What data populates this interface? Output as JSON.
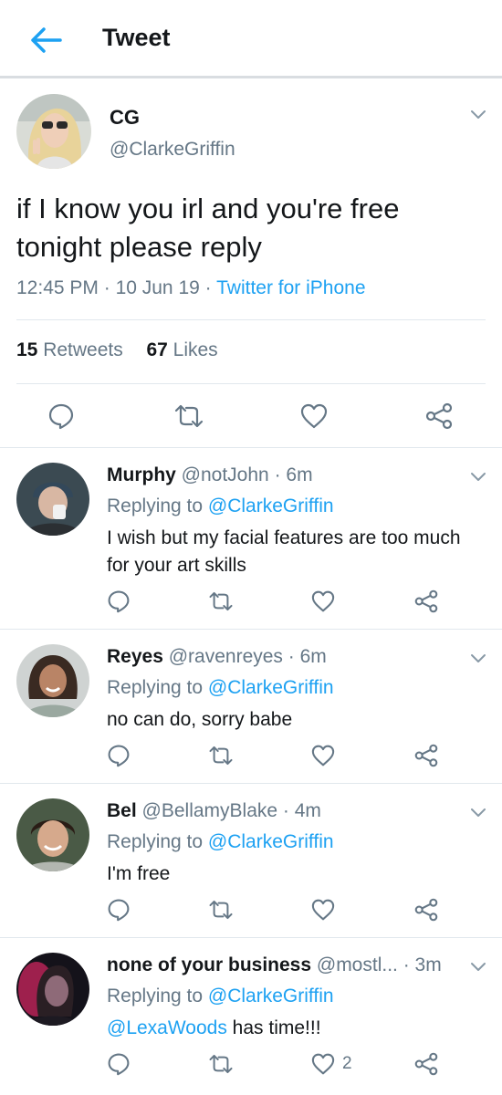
{
  "header": {
    "title": "Tweet"
  },
  "main_tweet": {
    "name": "CG",
    "handle": "@ClarkeGriffin",
    "text": "if I know you irl and you're free tonight please reply",
    "time": "12:45 PM",
    "date": "10 Jun 19",
    "source": "Twitter for iPhone",
    "retweets_count": "15",
    "retweets_label": "Retweets",
    "likes_count": "67",
    "likes_label": "Likes"
  },
  "replies": [
    {
      "name": "Murphy",
      "handle": "@notJohn",
      "time": "6m",
      "replying_prefix": "Replying to",
      "replying_to": "@ClarkeGriffin",
      "text": "I wish but my facial features are too much for your art skills",
      "like_count": ""
    },
    {
      "name": "Reyes",
      "handle": "@ravenreyes",
      "time": "6m",
      "replying_prefix": "Replying to",
      "replying_to": "@ClarkeGriffin",
      "text": "no can do, sorry babe",
      "like_count": ""
    },
    {
      "name": "Bel",
      "handle": "@BellamyBlake",
      "time": "4m",
      "replying_prefix": "Replying to",
      "replying_to": "@ClarkeGriffin",
      "text": "I'm free",
      "like_count": ""
    },
    {
      "name": "none of your business",
      "handle": "@mostl...",
      "time": "3m",
      "replying_prefix": "Replying to",
      "replying_to": "@ClarkeGriffin",
      "text_mention": "@LexaWoods",
      "text_rest": " has time!!!",
      "like_count": "2"
    }
  ],
  "colors": {
    "accent": "#1da1f2",
    "icon_gray": "#657786",
    "text": "#14171a",
    "divider": "#e1e8ed"
  }
}
